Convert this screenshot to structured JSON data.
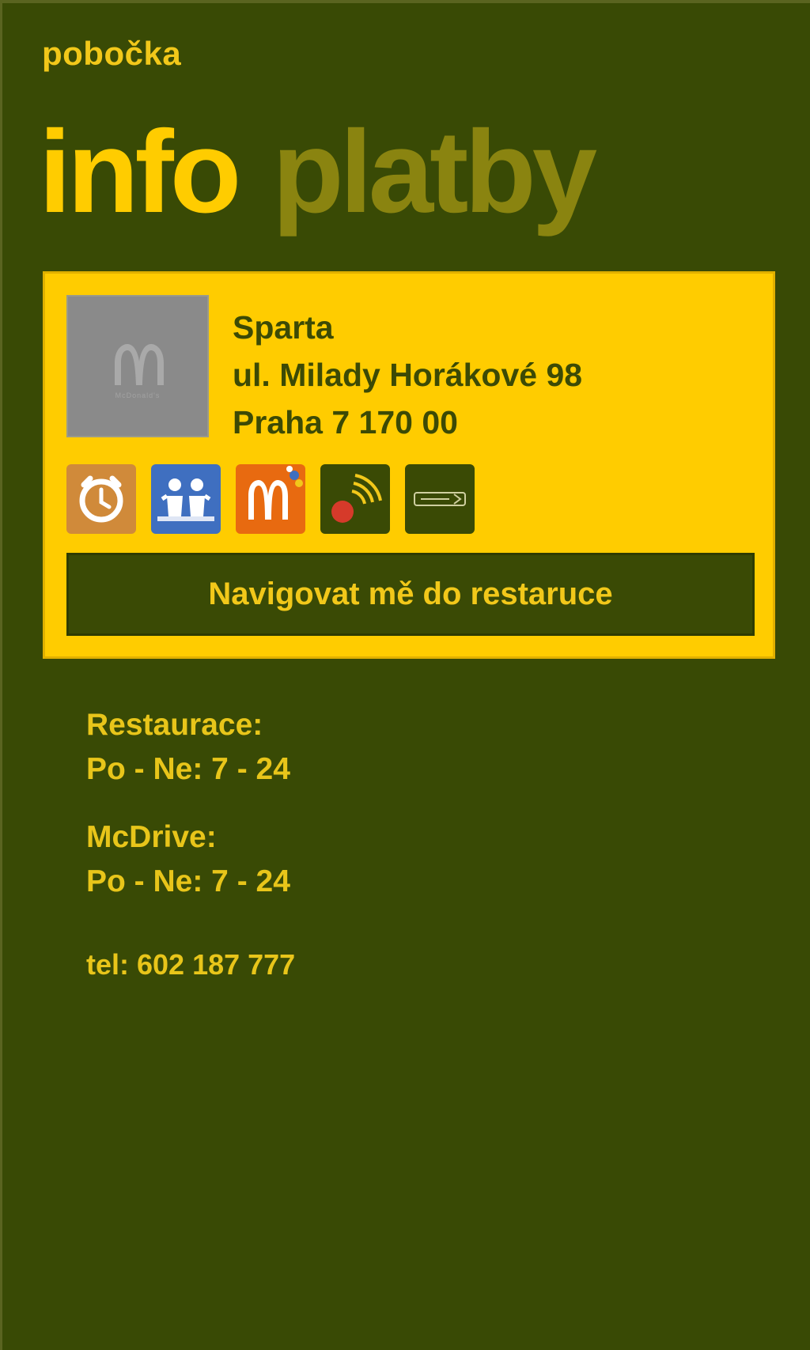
{
  "app": {
    "title": "pobočka"
  },
  "pivot": {
    "items": [
      "info",
      "platby"
    ],
    "active": "info"
  },
  "branch": {
    "name": "Sparta",
    "street": "ul. Milady Horákové 98",
    "city": "Praha 7 170 00",
    "image_caption": "McDonald's"
  },
  "services": [
    {
      "icon": "breakfast-clock-icon",
      "color": "#d08a3a"
    },
    {
      "icon": "playland-icon",
      "color": "#3f6fc0"
    },
    {
      "icon": "mccafe-logo-icon",
      "color": "#e86a10"
    },
    {
      "icon": "wifi-icon",
      "color": "#3a4a05"
    },
    {
      "icon": "paywave-card-icon",
      "color": "#3a4a05"
    }
  ],
  "navigate_button": "Navigovat mě do restaruce",
  "hours": {
    "restaurant_label": "Restaurace:",
    "restaurant_value": "Po - Ne: 7 - 24",
    "drive_label": "McDrive:",
    "drive_value": "Po - Ne: 7 - 24"
  },
  "phone": "tel: 602 187 777",
  "colors": {
    "background": "#394a05",
    "accent": "#ffcc00",
    "inactive_pivot": "#8a8410"
  }
}
